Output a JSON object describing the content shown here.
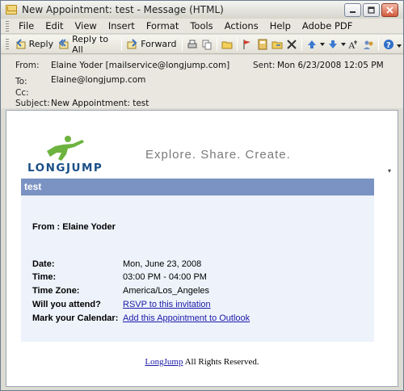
{
  "window": {
    "title": "New Appointment: test - Message (HTML)"
  },
  "menu": {
    "items": [
      "File",
      "Edit",
      "View",
      "Insert",
      "Format",
      "Tools",
      "Actions",
      "Help",
      "Adobe PDF"
    ]
  },
  "toolbar": {
    "reply_label": "Reply",
    "reply_all_label": "Reply to All",
    "forward_label": "Forward"
  },
  "header": {
    "from_label": "From:",
    "from_value": "Elaine Yoder [mailservice@longjump.com]",
    "sent_label": "Sent:",
    "sent_value": "Mon 6/23/2008 12:05 PM",
    "to_label": "To:",
    "to_value": "Elaine@longjump.com",
    "cc_label": "Cc:",
    "cc_value": "",
    "subject_label": "Subject:",
    "subject_value": "New Appointment: test"
  },
  "message": {
    "logo_text": "LONGJUMP",
    "tagline": "Explore. Share. Create.",
    "card_title": "test",
    "from_line": "From : Elaine Yoder",
    "details": {
      "date_label": "Date:",
      "date_value": "Mon, June 23, 2008",
      "time_label": "Time:",
      "time_value": "03:00 PM - 04:00 PM",
      "timezone_label": "Time Zone:",
      "timezone_value": "America/Los_Angeles",
      "attend_label": "Will you attend?",
      "attend_link": "RSVP to this invitation",
      "calendar_label": "Mark your Calendar:",
      "calendar_link": "Add this Appointment to Outlook"
    },
    "footer_link": "LongJump",
    "footer_text": " All Rights Reserved."
  },
  "colors": {
    "card_header": "#7b93c3",
    "card_bg": "#eef3fb",
    "logo_blue": "#1a4f86",
    "logo_green": "#6db33f",
    "link": "#1a1aa8"
  }
}
